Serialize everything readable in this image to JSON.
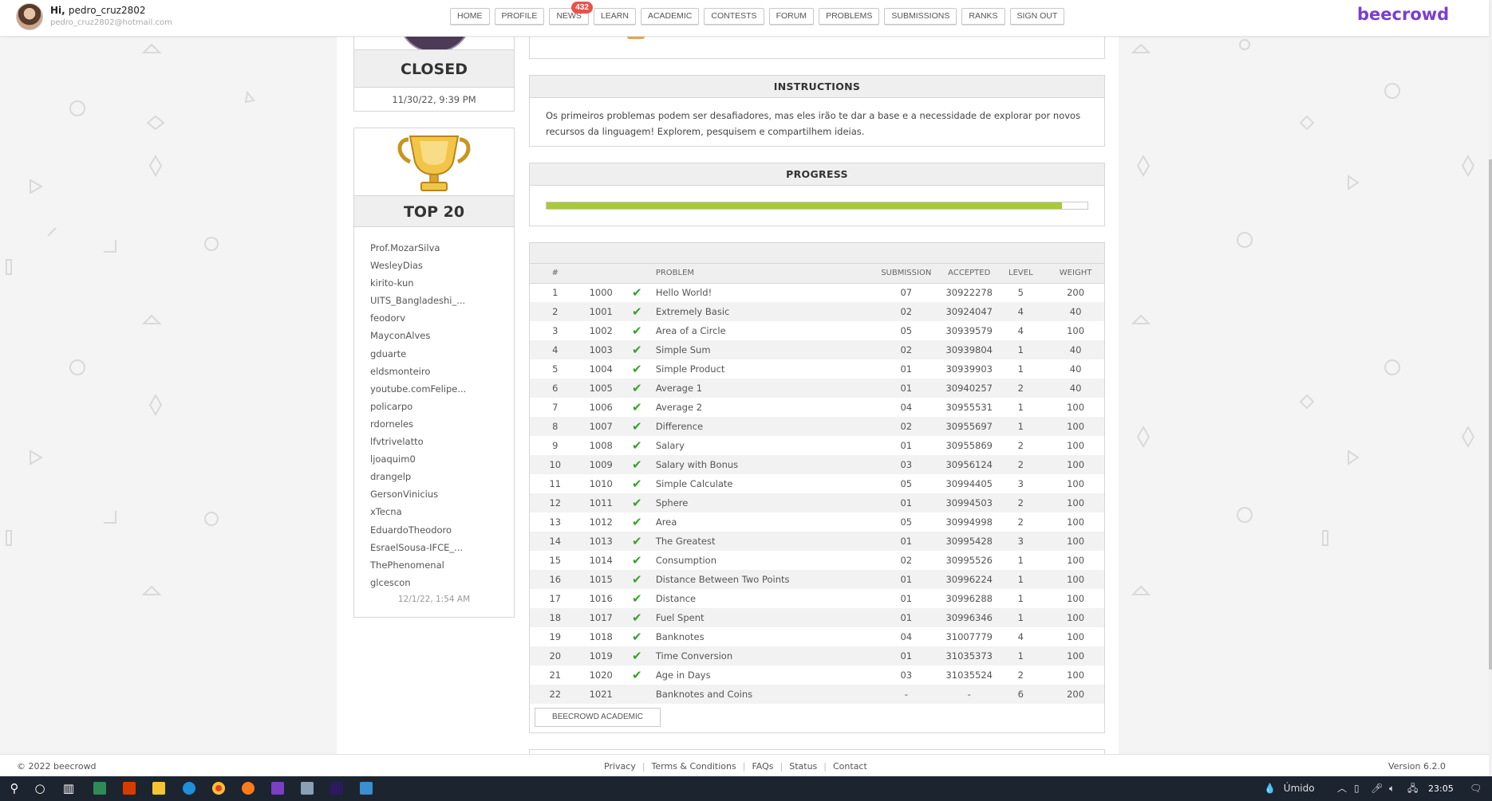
{
  "header": {
    "greeting_prefix": "Hi, ",
    "username": "pedro_cruz2802",
    "email": "pedro_cruz2802@hotmail.com",
    "brand": "beecrowd",
    "nav": [
      "HOME",
      "PROFILE",
      "NEWS",
      "LEARN",
      "ACADEMIC",
      "CONTESTS",
      "FORUM",
      "PROBLEMS",
      "SUBMISSIONS",
      "RANKS",
      "SIGN OUT"
    ],
    "news_badge": "432"
  },
  "closed_panel": {
    "title": "CLOSED",
    "date": "11/30/22, 9:39 PM"
  },
  "top_panel": {
    "title": "TOP 20",
    "users": [
      "Prof.MozarSilva",
      "WesleyDias",
      "kirito-kun",
      "UITS_Bangladeshi_...",
      "feodorv",
      "MayconAlves",
      "gduarte",
      "eldsmonteiro",
      "youtube.comFelipe...",
      "policarpo",
      "rdorneles",
      "lfvtrivelatto",
      "ljoaquim0",
      "drangelp",
      "GersonVinicius",
      "xTecna",
      "EduardoTheodoro",
      "EsraelSousa-IFCE_...",
      "ThePhenomenal",
      "glcescon"
    ],
    "date": "12/1/22, 1:54 AM"
  },
  "instructions": {
    "title": "INSTRUCTIONS",
    "text": "Os primeiros problemas podem ser desafiadores, mas eles irão te dar a base e a necessidade de explorar por novos recursos da linguagem! Explorem, pesquisem e compartilhem ideias."
  },
  "progress": {
    "title": "PROGRESS",
    "value": 0.953
  },
  "problems": {
    "columns": [
      "#",
      "PROBLEM",
      "SUBMISSION",
      "ACCEPTED",
      "LEVEL",
      "WEIGHT"
    ],
    "rows": [
      {
        "n": "1",
        "id": "1000",
        "ok": true,
        "name": "Hello World!",
        "sub": "07",
        "acc": "30922278",
        "level": "5",
        "weight": "200"
      },
      {
        "n": "2",
        "id": "1001",
        "ok": true,
        "name": "Extremely Basic",
        "sub": "02",
        "acc": "30924047",
        "level": "4",
        "weight": "40"
      },
      {
        "n": "3",
        "id": "1002",
        "ok": true,
        "name": "Area of a Circle",
        "sub": "05",
        "acc": "30939579",
        "level": "4",
        "weight": "100"
      },
      {
        "n": "4",
        "id": "1003",
        "ok": true,
        "name": "Simple Sum",
        "sub": "02",
        "acc": "30939804",
        "level": "1",
        "weight": "40"
      },
      {
        "n": "5",
        "id": "1004",
        "ok": true,
        "name": "Simple Product",
        "sub": "01",
        "acc": "30939903",
        "level": "1",
        "weight": "40"
      },
      {
        "n": "6",
        "id": "1005",
        "ok": true,
        "name": "Average 1",
        "sub": "01",
        "acc": "30940257",
        "level": "2",
        "weight": "40"
      },
      {
        "n": "7",
        "id": "1006",
        "ok": true,
        "name": "Average 2",
        "sub": "04",
        "acc": "30955531",
        "level": "1",
        "weight": "100"
      },
      {
        "n": "8",
        "id": "1007",
        "ok": true,
        "name": "Difference",
        "sub": "02",
        "acc": "30955697",
        "level": "1",
        "weight": "100"
      },
      {
        "n": "9",
        "id": "1008",
        "ok": true,
        "name": "Salary",
        "sub": "01",
        "acc": "30955869",
        "level": "2",
        "weight": "100"
      },
      {
        "n": "10",
        "id": "1009",
        "ok": true,
        "name": "Salary with Bonus",
        "sub": "03",
        "acc": "30956124",
        "level": "2",
        "weight": "100"
      },
      {
        "n": "11",
        "id": "1010",
        "ok": true,
        "name": "Simple Calculate",
        "sub": "05",
        "acc": "30994405",
        "level": "3",
        "weight": "100"
      },
      {
        "n": "12",
        "id": "1011",
        "ok": true,
        "name": "Sphere",
        "sub": "01",
        "acc": "30994503",
        "level": "2",
        "weight": "100"
      },
      {
        "n": "13",
        "id": "1012",
        "ok": true,
        "name": "Area",
        "sub": "05",
        "acc": "30994998",
        "level": "2",
        "weight": "100"
      },
      {
        "n": "14",
        "id": "1013",
        "ok": true,
        "name": "The Greatest",
        "sub": "01",
        "acc": "30995428",
        "level": "3",
        "weight": "100"
      },
      {
        "n": "15",
        "id": "1014",
        "ok": true,
        "name": "Consumption",
        "sub": "02",
        "acc": "30995526",
        "level": "1",
        "weight": "100"
      },
      {
        "n": "16",
        "id": "1015",
        "ok": true,
        "name": "Distance Between Two Points",
        "sub": "01",
        "acc": "30996224",
        "level": "1",
        "weight": "100"
      },
      {
        "n": "17",
        "id": "1016",
        "ok": true,
        "name": "Distance",
        "sub": "01",
        "acc": "30996288",
        "level": "1",
        "weight": "100"
      },
      {
        "n": "18",
        "id": "1017",
        "ok": true,
        "name": "Fuel Spent",
        "sub": "01",
        "acc": "30996346",
        "level": "1",
        "weight": "100"
      },
      {
        "n": "19",
        "id": "1018",
        "ok": true,
        "name": "Banknotes",
        "sub": "04",
        "acc": "31007779",
        "level": "4",
        "weight": "100"
      },
      {
        "n": "20",
        "id": "1019",
        "ok": true,
        "name": "Time Conversion",
        "sub": "01",
        "acc": "31035373",
        "level": "1",
        "weight": "100"
      },
      {
        "n": "21",
        "id": "1020",
        "ok": true,
        "name": "Age in Days",
        "sub": "03",
        "acc": "31035524",
        "level": "2",
        "weight": "100"
      },
      {
        "n": "22",
        "id": "1021",
        "ok": false,
        "name": "Banknotes and Coins",
        "sub": "-",
        "acc": "-",
        "level": "6",
        "weight": "200"
      }
    ],
    "academic_button": "BEECROWD ACADEMIC"
  },
  "footer": {
    "copyright": "© 2022 beecrowd",
    "links": [
      "Privacy",
      "Terms & Conditions",
      "FAQs",
      "Status",
      "Contact"
    ],
    "version": "Version 6.2.0"
  },
  "taskbar": {
    "weather": "Úmido",
    "time": "23:05"
  },
  "colors": {
    "brand": "#7a3ed0",
    "progress": "#a7c93a",
    "check": "#36a22a",
    "badge": "#e8524a"
  }
}
